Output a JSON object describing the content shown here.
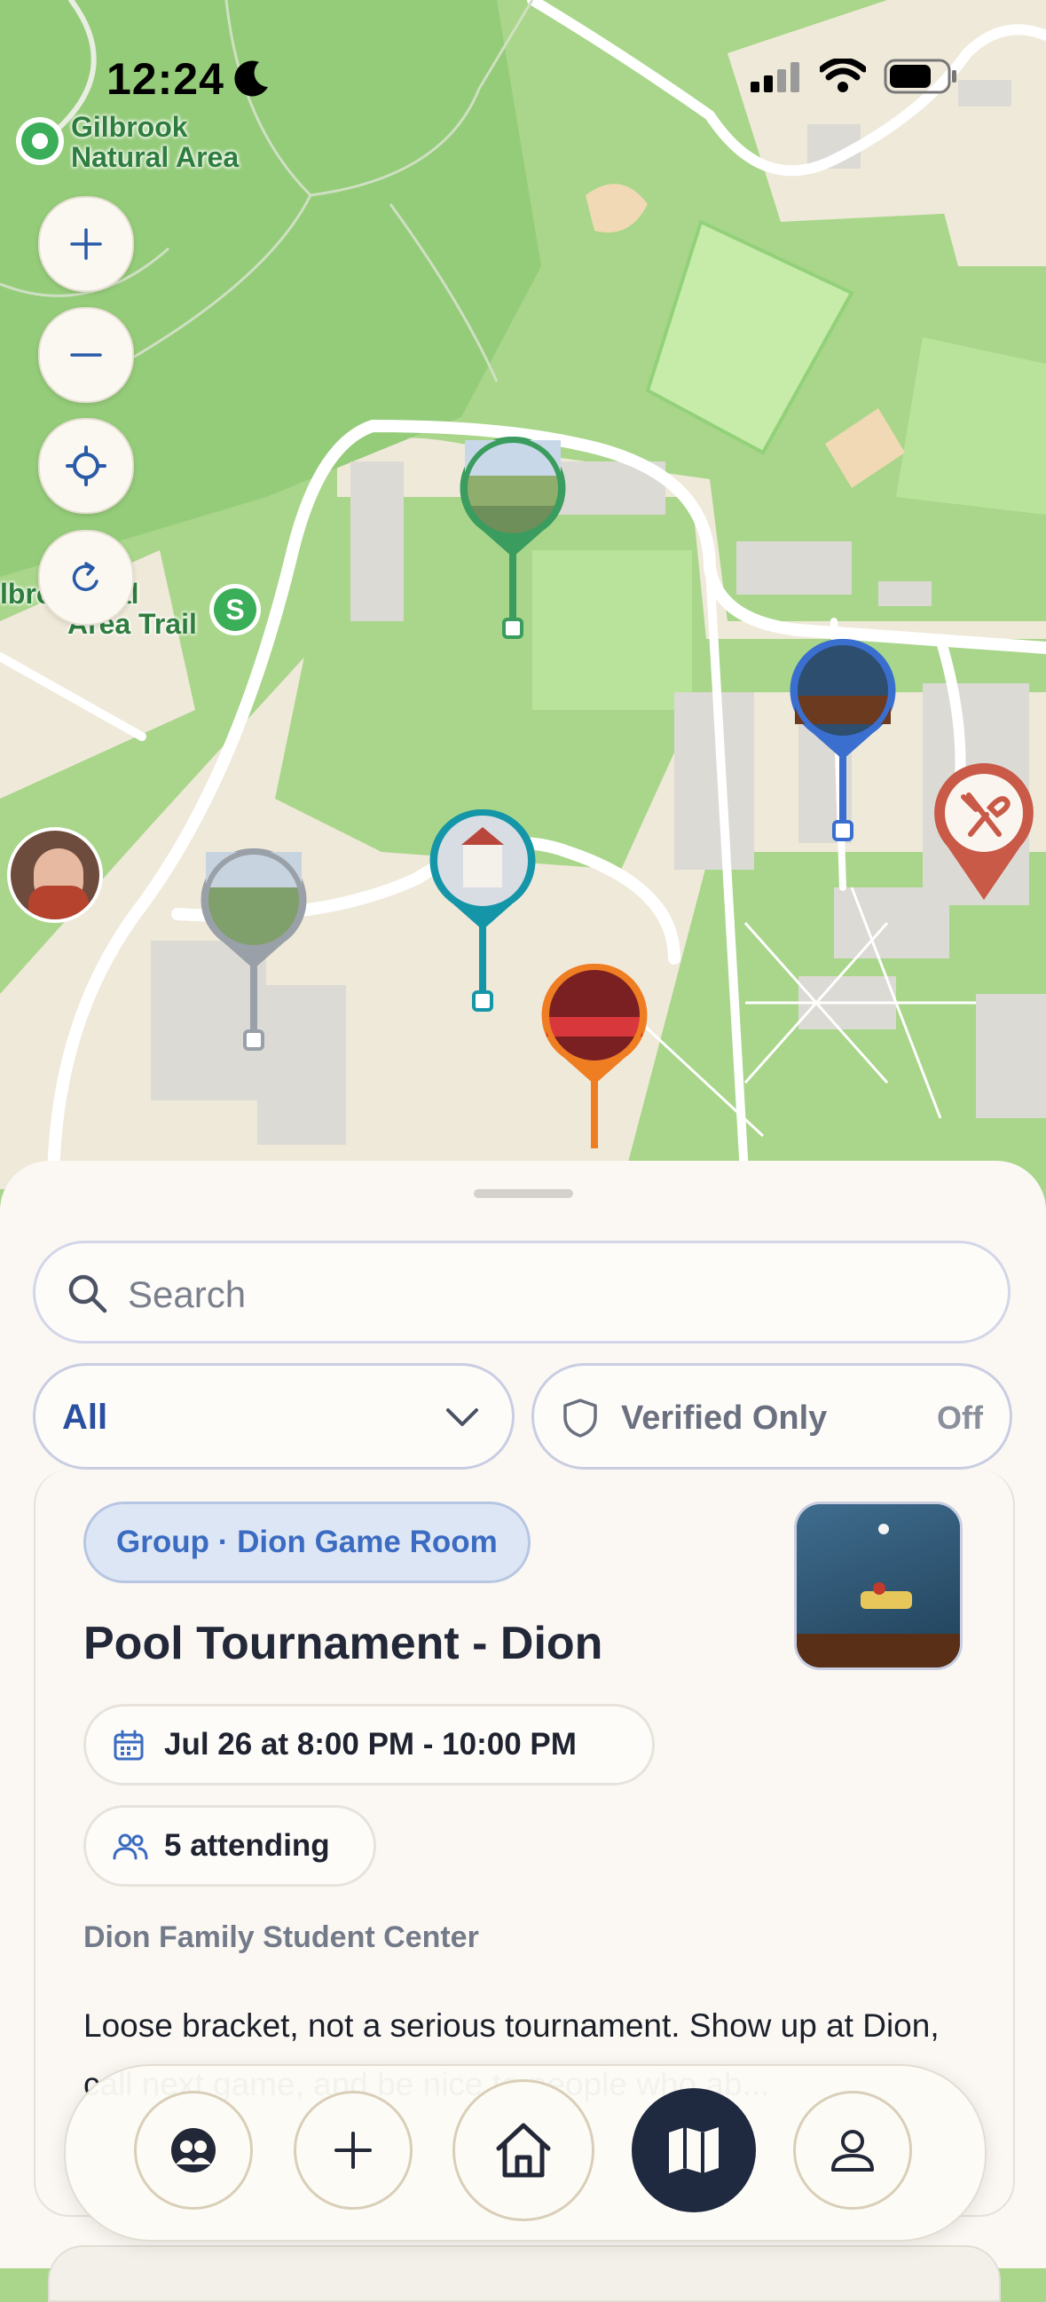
{
  "status_bar": {
    "time": "12:24"
  },
  "map": {
    "poi_gilbrook_area": [
      "Gilbrook",
      "Natural Area"
    ],
    "poi_trail": [
      "lbro  atural",
      "Area Trail"
    ]
  },
  "search": {
    "placeholder": "Search"
  },
  "filters": {
    "category": "All",
    "verified_label": "Verified Only",
    "verified_state": "Off"
  },
  "event": {
    "group_tag": "Group · Dion Game Room",
    "title": "Pool Tournament - Dion",
    "datetime": "Jul 26 at 8:00 PM - 10:00 PM",
    "attending": "5 attending",
    "location": "Dion Family Student Center",
    "description": "Loose bracket, not a serious tournament. Show up at Dion, call next game, and be nice to people who ab..."
  },
  "nav": [
    "groups",
    "create",
    "home",
    "map",
    "profile"
  ],
  "colors": {
    "accent": "#1f2940",
    "pin_green": "#3a9c5e",
    "pin_blue": "#3a6fd0",
    "pin_teal": "#1596a8",
    "pin_orange": "#ef7d22",
    "pin_gray": "#9aa0a7",
    "pin_restaurant": "#c85a47"
  }
}
